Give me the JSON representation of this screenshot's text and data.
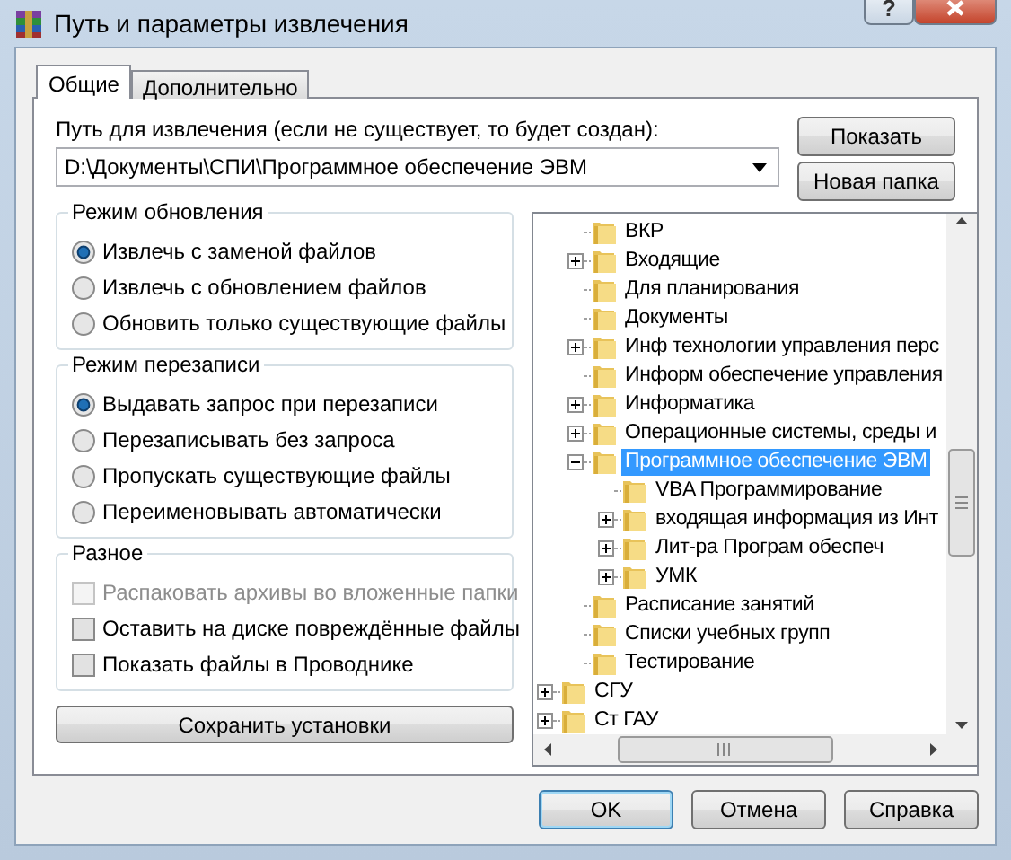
{
  "window": {
    "title": "Путь и параметры извлечения",
    "help": "?"
  },
  "tabs": [
    {
      "label": "Общие",
      "selected": true
    },
    {
      "label": "Дополнительно",
      "selected": false
    }
  ],
  "path": {
    "label": "Путь для извлечения (если не существует, то будет создан):",
    "value": "D:\\Документы\\СПИ\\Программное обеспечение ЭВМ"
  },
  "side_buttons": [
    "Показать",
    "Новая папка"
  ],
  "update_mode": {
    "title": "Режим обновления",
    "options": [
      {
        "label": "Извлечь с заменой файлов",
        "selected": true
      },
      {
        "label": "Извлечь с обновлением файлов",
        "selected": false
      },
      {
        "label": "Обновить только существующие файлы",
        "selected": false
      }
    ]
  },
  "overwrite_mode": {
    "title": "Режим перезаписи",
    "options": [
      {
        "label": "Выдавать запрос при перезаписи",
        "selected": true
      },
      {
        "label": "Перезаписывать без запроса",
        "selected": false
      },
      {
        "label": "Пропускать существующие файлы",
        "selected": false
      },
      {
        "label": "Переименовывать автоматически",
        "selected": false
      }
    ]
  },
  "misc": {
    "title": "Разное",
    "options": [
      {
        "label": "Распаковать архивы во вложенные папки",
        "checked": false,
        "disabled": true
      },
      {
        "label": "Оставить на диске повреждённые файлы",
        "checked": false,
        "disabled": false
      },
      {
        "label": "Показать файлы в Проводнике",
        "checked": false,
        "disabled": false
      }
    ]
  },
  "save_button": "Сохранить установки",
  "tree": {
    "continued_items": [
      {
        "label": "ВКР",
        "kind": "leaf",
        "selected": false
      },
      {
        "label": "Входящие",
        "kind": "branch",
        "expanded": false,
        "selected": false
      },
      {
        "label": "Для  планирования",
        "kind": "leaf",
        "selected": false
      },
      {
        "label": "Документы",
        "kind": "leaf",
        "selected": false
      },
      {
        "label": "Инф технологии управления перс",
        "kind": "branch",
        "expanded": false,
        "selected": false
      },
      {
        "label": "Информ обеспечение управления",
        "kind": "leaf",
        "selected": false
      },
      {
        "label": "Информатика",
        "kind": "branch",
        "expanded": false,
        "selected": false
      },
      {
        "label": "Операционные системы, среды и",
        "kind": "branch",
        "expanded": false,
        "selected": false
      },
      {
        "label": "Программное обеспечение ЭВМ",
        "kind": "branch",
        "expanded": true,
        "selected": true,
        "children": [
          {
            "label": "VBA Программирование",
            "kind": "leaf",
            "selected": false
          },
          {
            "label": "входящая информация из Инт",
            "kind": "branch",
            "expanded": false,
            "selected": false
          },
          {
            "label": "Лит-ра Програм обеспеч",
            "kind": "branch",
            "expanded": false,
            "selected": false
          },
          {
            "label": "УМК",
            "kind": "branch",
            "expanded": false,
            "selected": false
          }
        ]
      },
      {
        "label": "Расписание занятий",
        "kind": "leaf",
        "selected": false
      },
      {
        "label": "Списки учебных групп",
        "kind": "leaf",
        "selected": false
      },
      {
        "label": "Тестирование",
        "kind": "leaf",
        "selected": false
      }
    ],
    "items": [
      {
        "label": "СГУ",
        "kind": "branch",
        "expanded": false,
        "selected": false
      },
      {
        "label": "Ст ГАУ",
        "kind": "branch",
        "expanded": false,
        "selected": false
      }
    ]
  },
  "footer_buttons": [
    {
      "label": "OK",
      "default": true
    },
    {
      "label": "Отмена",
      "default": false
    },
    {
      "label": "Справка",
      "default": false
    }
  ]
}
